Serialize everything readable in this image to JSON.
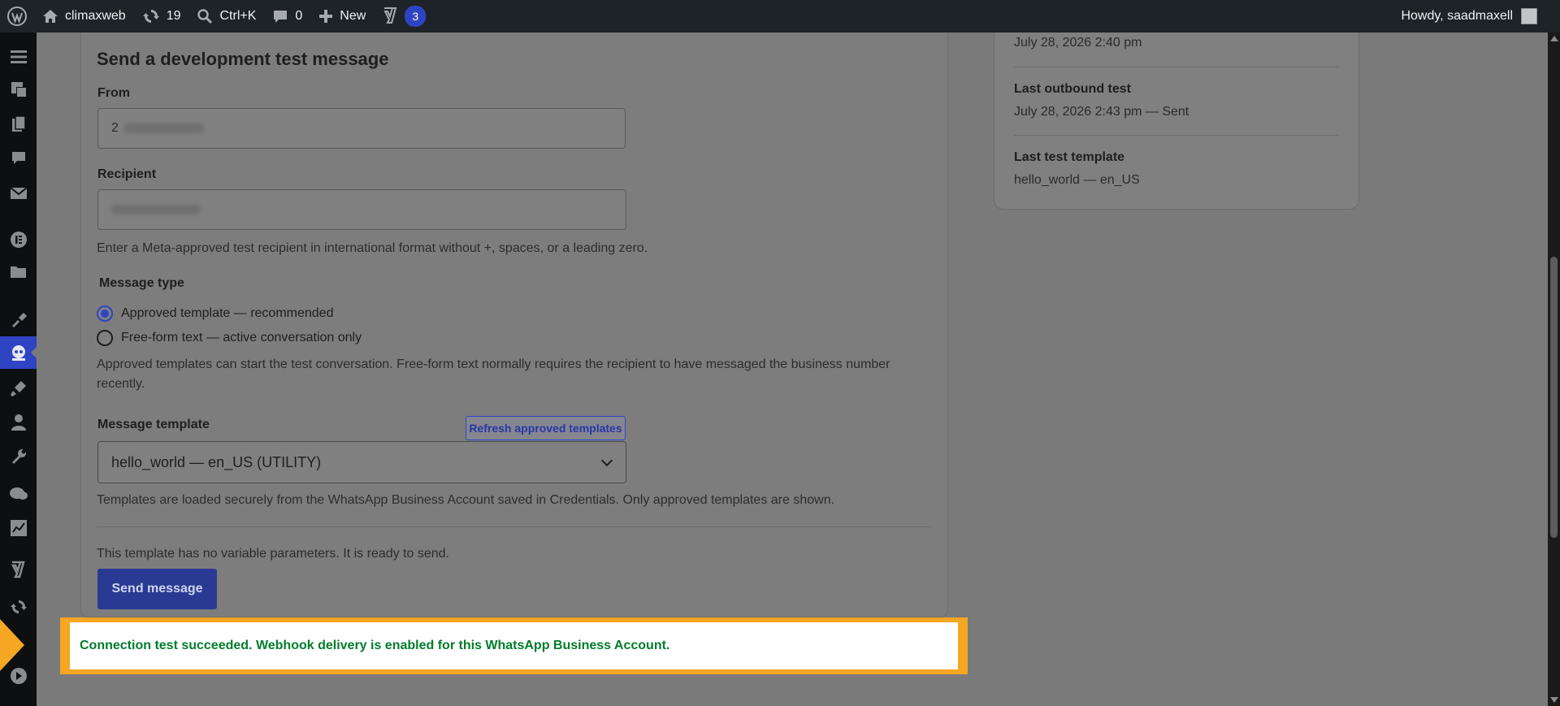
{
  "adminbar": {
    "site_name": "climaxweb",
    "updates_count": "19",
    "search_shortcut": "Ctrl+K",
    "comments_count": "0",
    "new_label": "New",
    "yoast_badge": "3",
    "greeting": "Howdy, saadmaxell"
  },
  "form": {
    "section_title": "Send a development test message",
    "from_label": "From",
    "from_value": "2",
    "recipient_label": "Recipient",
    "recipient_help": "Enter a Meta-approved test recipient in international format without +, spaces, or a leading zero.",
    "message_type_label": "Message type",
    "option_template": "Approved template — recommended",
    "option_freeform": "Free-form text — active conversation only",
    "selected_option": "template",
    "message_type_help": "Approved templates can start the test conversation. Free-form text normally requires the recipient to have messaged the business number",
    "message_type_help_2": "recently.",
    "template_label": "Message template",
    "refresh_button": "Refresh approved templates",
    "template_selected": "hello_world — en_US (UTILITY)",
    "template_help": "Templates are loaded securely from the WhatsApp Business Account saved in Credentials. Only approved templates are shown.",
    "no_params_text": "This template has no variable parameters. It is ready to send.",
    "send_button": "Send message"
  },
  "status_panel": {
    "top_value": "July 28, 2026 2:40 pm",
    "outbound_label": "Last outbound test",
    "outbound_value": "July 28, 2026 2:43 pm — Sent",
    "template_label": "Last test template",
    "template_value": "hello_world — en_US"
  },
  "notice": {
    "message": "Connection test succeeded. Webhook delivery is enabled for this WhatsApp Business Account.",
    "color": "#007c2b",
    "highlight_color": "#f5a623"
  },
  "colors": {
    "accent": "#2e44c2",
    "adminbar_bg": "#1d2327"
  }
}
